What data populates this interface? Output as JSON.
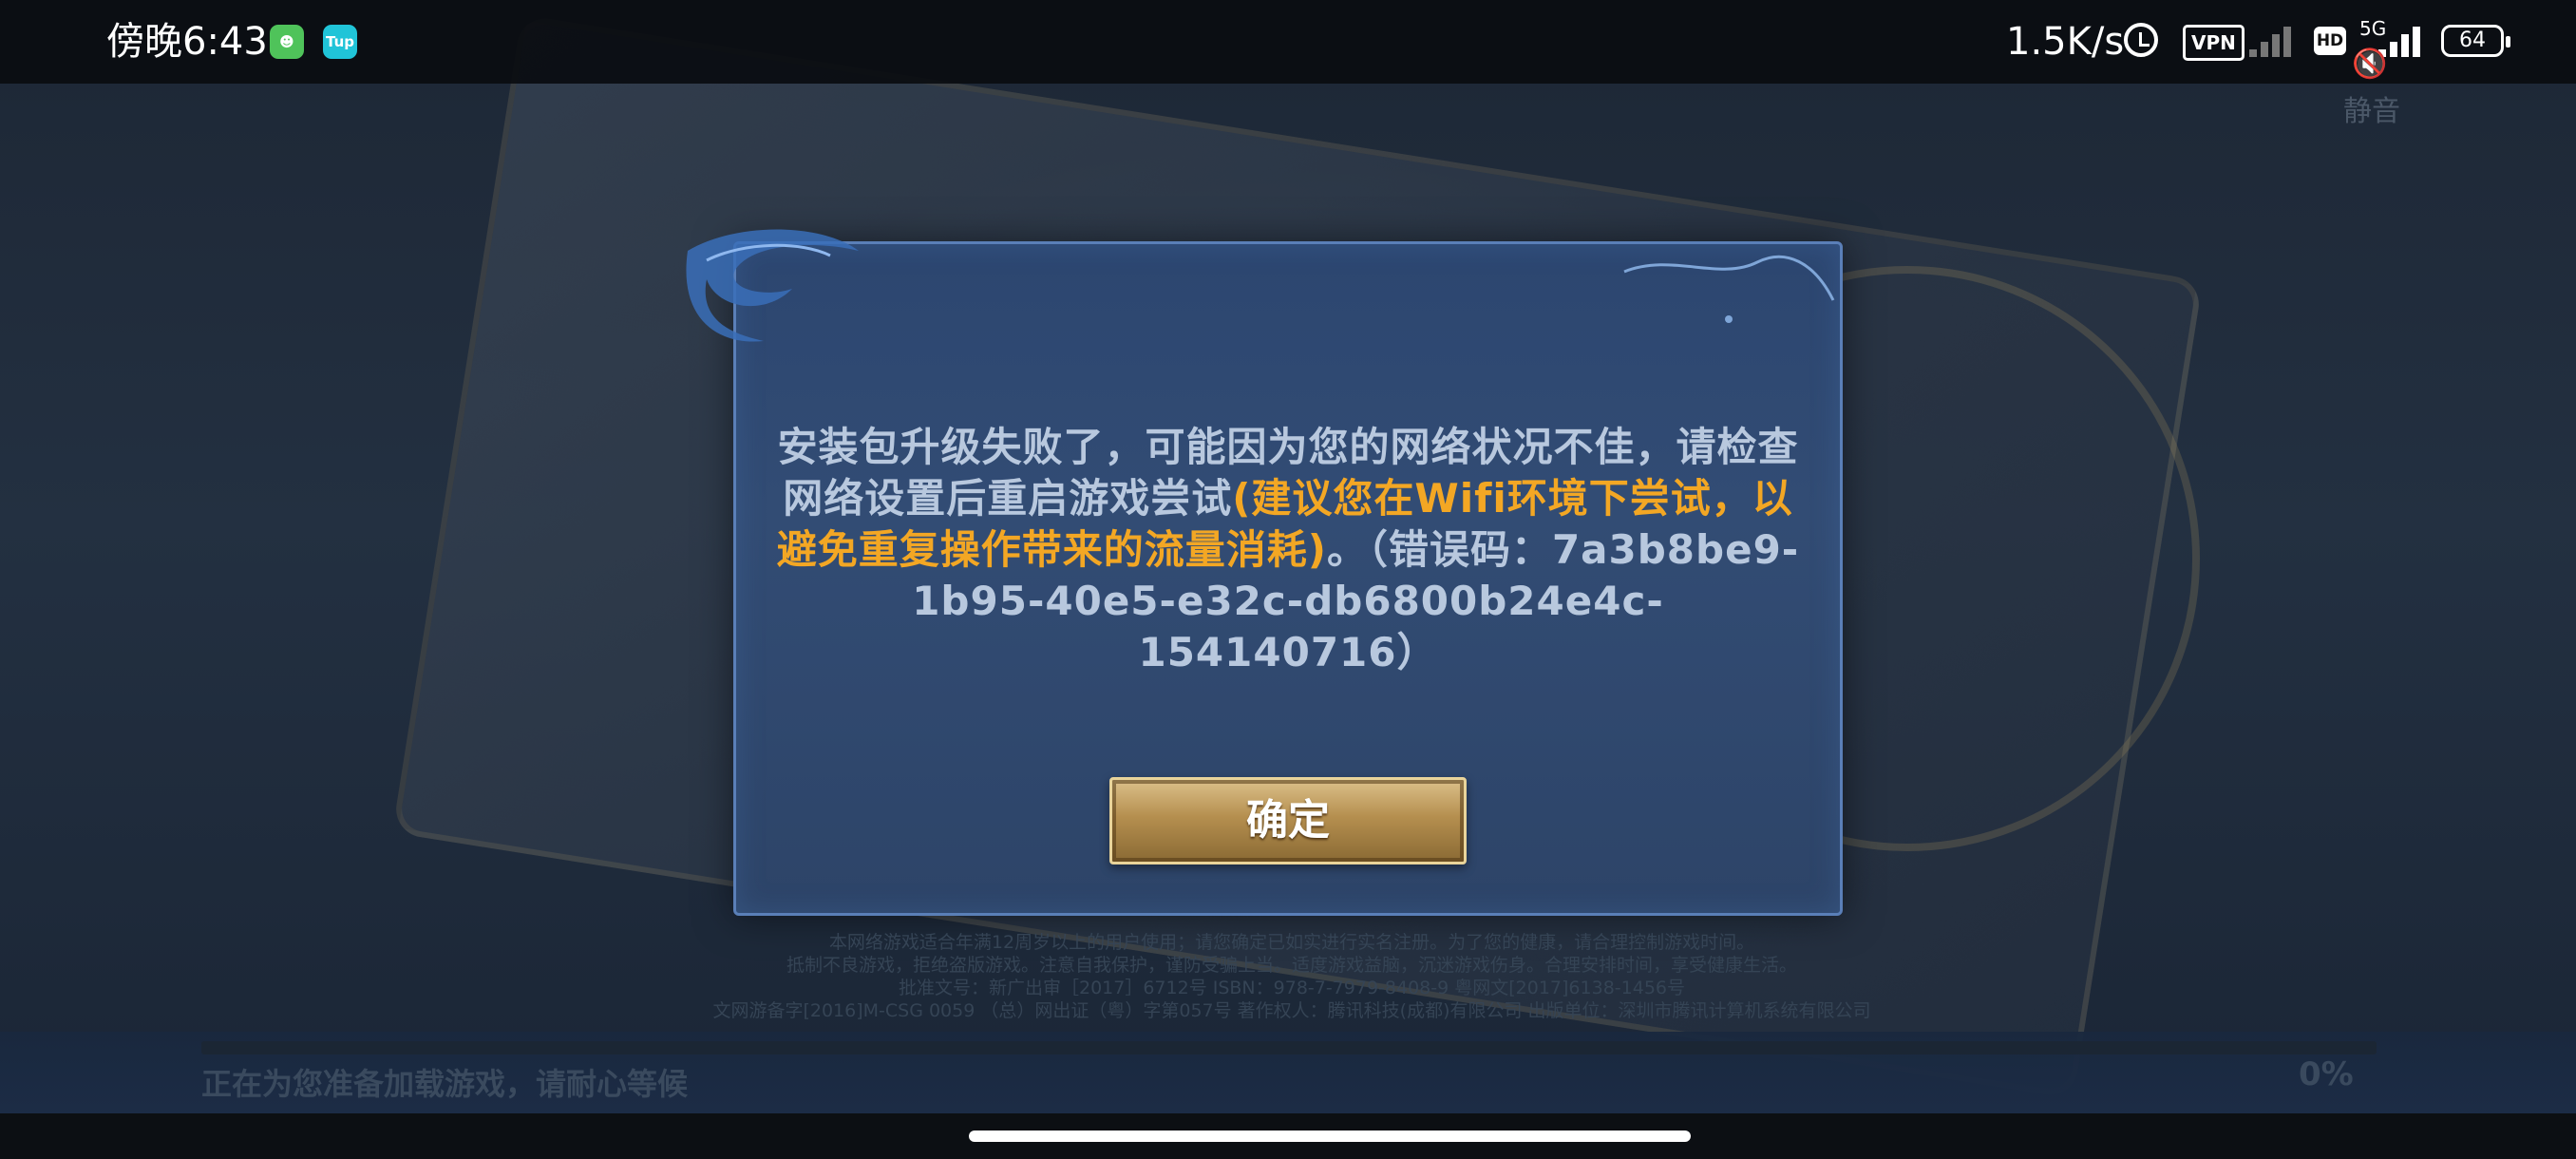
{
  "status_bar": {
    "time": "傍晚6:43",
    "app1_icon": "android-green-icon",
    "app2_label": "Tup",
    "net_speed": "1.5K/s",
    "vpn": "VPN",
    "hd": "HD",
    "network_type": "5G",
    "battery": "64"
  },
  "mute_label": "静音",
  "dialog": {
    "message_part1": "安装包升级失败了，可能因为您的网络状况不佳，请检查网络设置后重启游戏尝试",
    "message_highlight": "(建议您在Wifi环境下尝试，以避免重复操作带来的流量消耗)",
    "message_part2": "。（错误码：7a3b8be9-1b95-40e5-e32c-db6800b24e4c-154140716）",
    "confirm_label": "确定",
    "highlight_color": "#f3a724"
  },
  "legal": {
    "line1": "本网络游戏适合年满12周岁以上的用户使用；请您确定已如实进行实名注册。为了您的健康，请合理控制游戏时间。",
    "line2": "抵制不良游戏，拒绝盗版游戏。注意自我保护，谨防受骗上当。适度游戏益脑，沉迷游戏伤身。合理安排时间，享受健康生活。",
    "line3": "批准文号：新广出审［2017］6712号 ISBN：978-7-7979-8408-9 粤网文[2017]6138-1456号",
    "line4": "文网游备字[2016]M-CSG 0059 （总）网出证（粤）字第057号 著作权人：腾讯科技(成都)有限公司 出版单位：深圳市腾讯计算机系统有限公司"
  },
  "loading": {
    "text": "正在为您准备加载游戏，请耐心等候",
    "percent": "0%",
    "progress": 0
  }
}
